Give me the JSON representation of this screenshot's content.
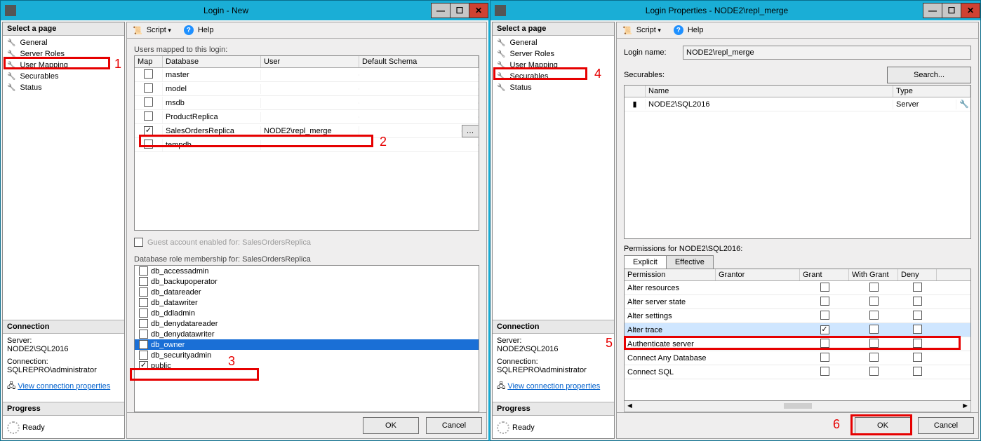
{
  "left": {
    "title": "Login - New",
    "toolbar": {
      "script": "Script",
      "help": "Help"
    },
    "sidebar": {
      "select": "Select a page",
      "pages": [
        "General",
        "Server Roles",
        "User Mapping",
        "Securables",
        "Status"
      ],
      "connection_hdr": "Connection",
      "server_lbl": "Server:",
      "server_val": "NODE2\\SQL2016",
      "conn_lbl": "Connection:",
      "conn_val": "SQLREPRO\\administrator",
      "view_conn": "View connection properties",
      "progress_hdr": "Progress",
      "ready": "Ready"
    },
    "um": {
      "caption": "Users mapped to this login:",
      "cols": {
        "map": "Map",
        "db": "Database",
        "user": "User",
        "schema": "Default Schema"
      },
      "rows": [
        {
          "db": "master",
          "checked": false,
          "user": "",
          "schema": ""
        },
        {
          "db": "model",
          "checked": false,
          "user": "",
          "schema": ""
        },
        {
          "db": "msdb",
          "checked": false,
          "user": "",
          "schema": ""
        },
        {
          "db": "ProductReplica",
          "checked": false,
          "user": "",
          "schema": ""
        },
        {
          "db": "SalesOrdersReplica",
          "checked": true,
          "user": "NODE2\\repl_merge",
          "schema": ""
        },
        {
          "db": "tempdb",
          "checked": false,
          "user": "",
          "schema": ""
        }
      ],
      "guest": "Guest account enabled for: SalesOrdersReplica",
      "roles_caption": "Database role membership for: SalesOrdersReplica",
      "roles": [
        {
          "name": "db_accessadmin",
          "checked": false
        },
        {
          "name": "db_backupoperator",
          "checked": false
        },
        {
          "name": "db_datareader",
          "checked": false
        },
        {
          "name": "db_datawriter",
          "checked": false
        },
        {
          "name": "db_ddladmin",
          "checked": false
        },
        {
          "name": "db_denydatareader",
          "checked": false
        },
        {
          "name": "db_denydatawriter",
          "checked": false
        },
        {
          "name": "db_owner",
          "checked": true,
          "selected": true
        },
        {
          "name": "db_securityadmin",
          "checked": false
        },
        {
          "name": "public",
          "checked": true
        }
      ]
    },
    "buttons": {
      "ok": "OK",
      "cancel": "Cancel"
    }
  },
  "right": {
    "title": "Login Properties - NODE2\\repl_merge",
    "toolbar": {
      "script": "Script",
      "help": "Help"
    },
    "sidebar": {
      "select": "Select a page",
      "pages": [
        "General",
        "Server Roles",
        "User Mapping",
        "Securables",
        "Status"
      ],
      "connection_hdr": "Connection",
      "server_lbl": "Server:",
      "server_val": "NODE2\\SQL2016",
      "conn_lbl": "Connection:",
      "conn_val": "SQLREPRO\\administrator",
      "view_conn": "View connection properties",
      "progress_hdr": "Progress",
      "ready": "Ready"
    },
    "sec": {
      "login_lbl": "Login name:",
      "login_val": "NODE2\\repl_merge",
      "securables_lbl": "Securables:",
      "search": "Search...",
      "cols": {
        "name": "Name",
        "type": "Type"
      },
      "items": [
        {
          "name": "NODE2\\SQL2016",
          "type": "Server"
        }
      ],
      "perm_caption": "Permissions for NODE2\\SQL2016:",
      "tabs": {
        "explicit": "Explicit",
        "effective": "Effective"
      },
      "perm_cols": {
        "perm": "Permission",
        "grantor": "Grantor",
        "grant": "Grant",
        "withgrant": "With Grant",
        "deny": "Deny"
      },
      "perms": [
        {
          "name": "Alter resources",
          "grant": false,
          "with": false,
          "deny": false
        },
        {
          "name": "Alter server state",
          "grant": false,
          "with": false,
          "deny": false
        },
        {
          "name": "Alter settings",
          "grant": false,
          "with": false,
          "deny": false
        },
        {
          "name": "Alter trace",
          "grant": true,
          "with": false,
          "deny": false,
          "selected": true
        },
        {
          "name": "Authenticate server",
          "grant": false,
          "with": false,
          "deny": false
        },
        {
          "name": "Connect Any Database",
          "grant": false,
          "with": false,
          "deny": false
        },
        {
          "name": "Connect SQL",
          "grant": false,
          "with": false,
          "deny": false
        }
      ]
    },
    "buttons": {
      "ok": "OK",
      "cancel": "Cancel"
    }
  },
  "annotations": {
    "n1": "1",
    "n2": "2",
    "n3": "3",
    "n4": "4",
    "n5": "5",
    "n6": "6"
  }
}
